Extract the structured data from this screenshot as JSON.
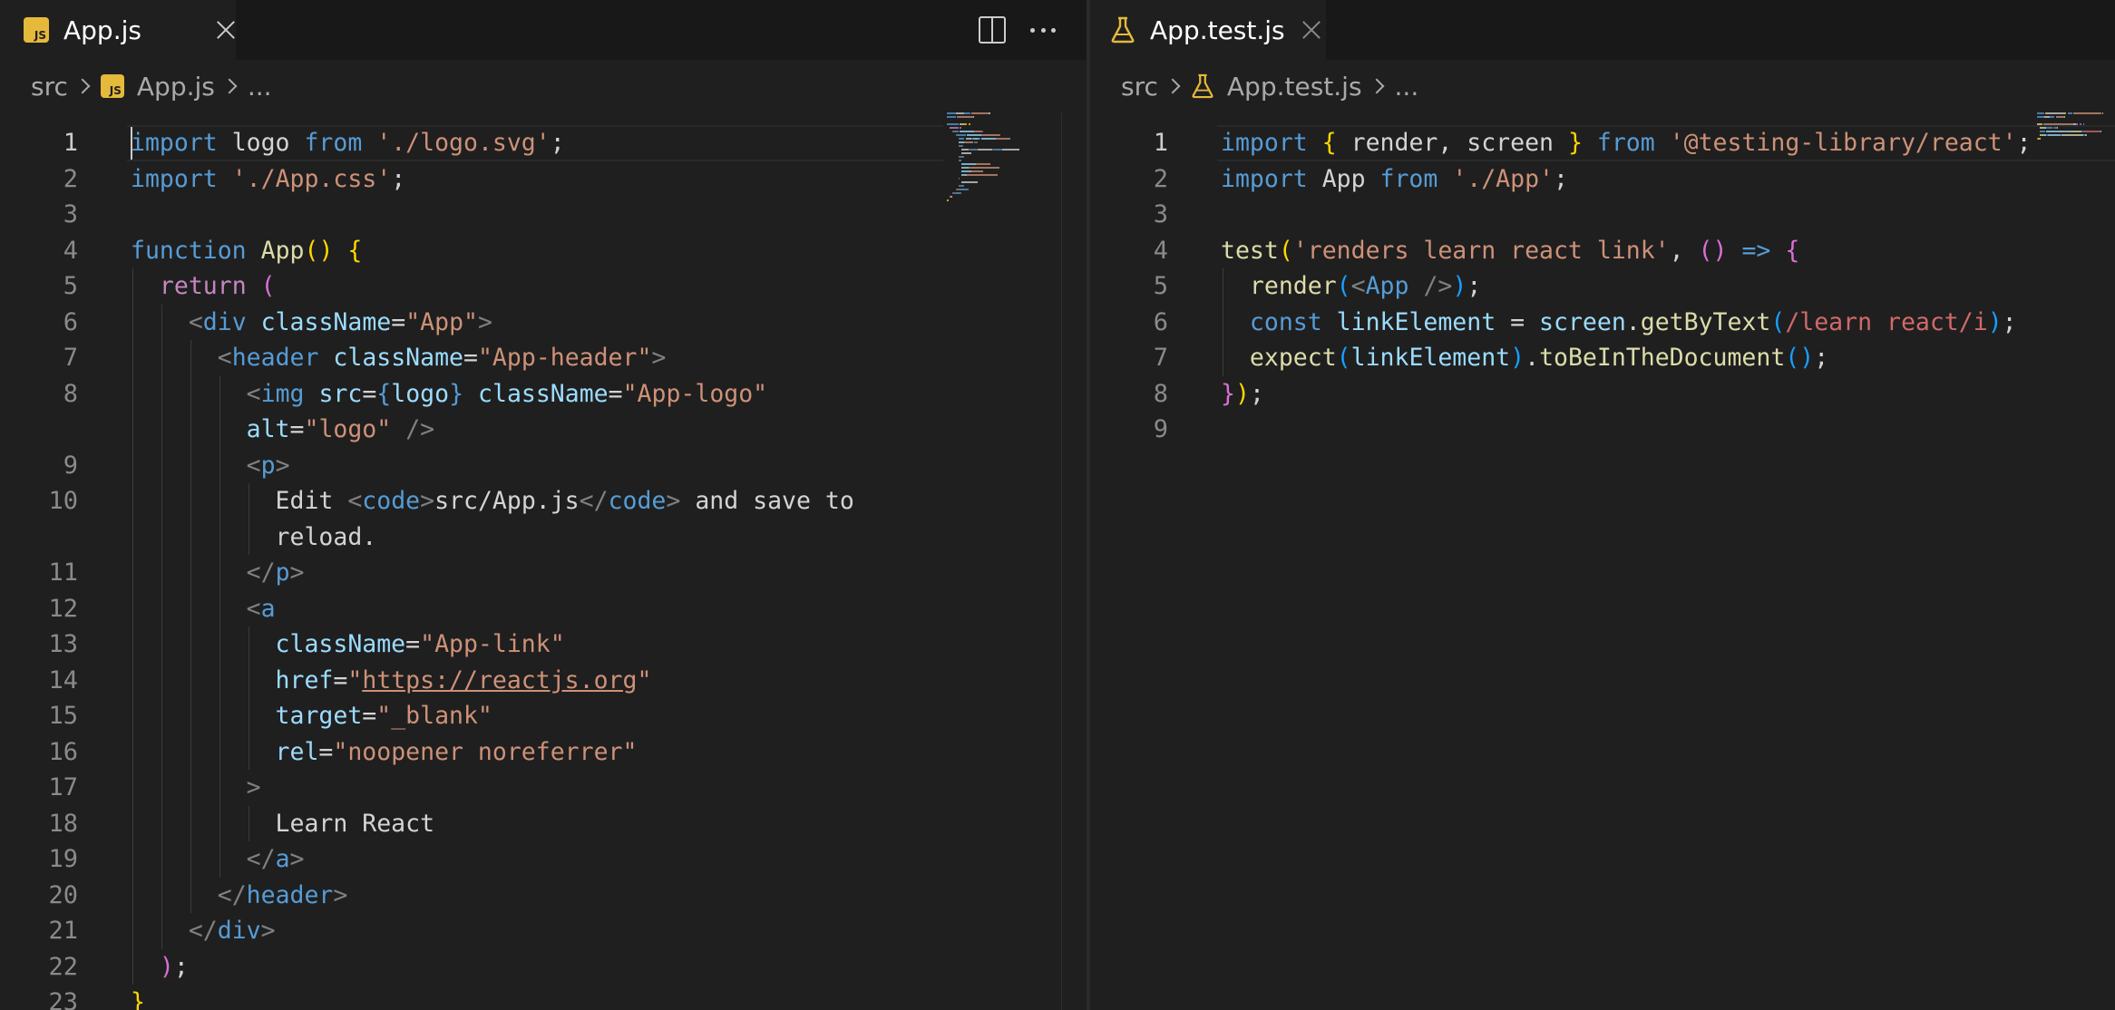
{
  "colors": {
    "editor_bg": "#1f1f1f",
    "tab_bar_bg": "#181818",
    "js_icon": "#e5b93a",
    "test_icon": "#e5b93a"
  },
  "left": {
    "tab": {
      "label": "App.js",
      "icon": "js-file-icon"
    },
    "breadcrumb": [
      "src",
      "App.js",
      "..."
    ],
    "current_line": 1,
    "lines": [
      {
        "n": "1",
        "i": 0,
        "t": [
          [
            "kw2",
            "import"
          ],
          [
            "txt",
            " logo "
          ],
          [
            "kw2",
            "from"
          ],
          [
            "txt",
            " "
          ],
          [
            "str",
            "'./logo.svg'"
          ],
          [
            "txt",
            ";"
          ]
        ]
      },
      {
        "n": "2",
        "i": 0,
        "t": [
          [
            "kw2",
            "import"
          ],
          [
            "txt",
            " "
          ],
          [
            "str",
            "'./App.css'"
          ],
          [
            "txt",
            ";"
          ]
        ]
      },
      {
        "n": "3",
        "i": 0,
        "t": []
      },
      {
        "n": "4",
        "i": 0,
        "t": [
          [
            "kw2",
            "function"
          ],
          [
            "txt",
            " "
          ],
          [
            "fn",
            "App"
          ],
          [
            "br1",
            "()"
          ],
          [
            "txt",
            " "
          ],
          [
            "br1",
            "{"
          ]
        ]
      },
      {
        "n": "5",
        "i": 1,
        "t": [
          [
            "kw",
            "return"
          ],
          [
            "txt",
            " "
          ],
          [
            "br2",
            "("
          ]
        ]
      },
      {
        "n": "6",
        "i": 2,
        "t": [
          [
            "punc",
            "<"
          ],
          [
            "tag",
            "div"
          ],
          [
            "txt",
            " "
          ],
          [
            "attr",
            "className"
          ],
          [
            "txt",
            "="
          ],
          [
            "str",
            "\"App\""
          ],
          [
            "punc",
            ">"
          ]
        ]
      },
      {
        "n": "7",
        "i": 3,
        "t": [
          [
            "punc",
            "<"
          ],
          [
            "tag",
            "header"
          ],
          [
            "txt",
            " "
          ],
          [
            "attr",
            "className"
          ],
          [
            "txt",
            "="
          ],
          [
            "str",
            "\"App-header\""
          ],
          [
            "punc",
            ">"
          ]
        ]
      },
      {
        "n": "8",
        "i": 4,
        "t": [
          [
            "punc",
            "<"
          ],
          [
            "tag",
            "img"
          ],
          [
            "txt",
            " "
          ],
          [
            "attr",
            "src"
          ],
          [
            "txt",
            "="
          ],
          [
            "kw2",
            "{"
          ],
          [
            "var",
            "logo"
          ],
          [
            "kw2",
            "}"
          ],
          [
            "txt",
            " "
          ],
          [
            "attr",
            "className"
          ],
          [
            "txt",
            "="
          ],
          [
            "str",
            "\"App-logo\""
          ]
        ]
      },
      {
        "n": "",
        "i": 4,
        "t": [
          [
            "attr",
            "alt"
          ],
          [
            "txt",
            "="
          ],
          [
            "str",
            "\"logo\""
          ],
          [
            "txt",
            " "
          ],
          [
            "punc",
            "/>"
          ]
        ]
      },
      {
        "n": "9",
        "i": 4,
        "t": [
          [
            "punc",
            "<"
          ],
          [
            "tag",
            "p"
          ],
          [
            "punc",
            ">"
          ]
        ]
      },
      {
        "n": "10",
        "i": 5,
        "t": [
          [
            "txt",
            "Edit "
          ],
          [
            "punc",
            "<"
          ],
          [
            "tag",
            "code"
          ],
          [
            "punc",
            ">"
          ],
          [
            "txt",
            "src/App.js"
          ],
          [
            "punc",
            "</"
          ],
          [
            "tag",
            "code"
          ],
          [
            "punc",
            ">"
          ],
          [
            "txt",
            " and save to"
          ]
        ]
      },
      {
        "n": "",
        "i": 5,
        "t": [
          [
            "txt",
            "reload."
          ]
        ]
      },
      {
        "n": "11",
        "i": 4,
        "t": [
          [
            "punc",
            "</"
          ],
          [
            "tag",
            "p"
          ],
          [
            "punc",
            ">"
          ]
        ]
      },
      {
        "n": "12",
        "i": 4,
        "t": [
          [
            "punc",
            "<"
          ],
          [
            "tag",
            "a"
          ]
        ]
      },
      {
        "n": "13",
        "i": 5,
        "t": [
          [
            "attr",
            "className"
          ],
          [
            "txt",
            "="
          ],
          [
            "str",
            "\"App-link\""
          ]
        ]
      },
      {
        "n": "14",
        "i": 5,
        "t": [
          [
            "attr",
            "href"
          ],
          [
            "txt",
            "="
          ],
          [
            "str",
            "\""
          ],
          [
            "link",
            "https://reactjs.org"
          ],
          [
            "str",
            "\""
          ]
        ]
      },
      {
        "n": "15",
        "i": 5,
        "t": [
          [
            "attr",
            "target"
          ],
          [
            "txt",
            "="
          ],
          [
            "str",
            "\"_blank\""
          ]
        ]
      },
      {
        "n": "16",
        "i": 5,
        "t": [
          [
            "attr",
            "rel"
          ],
          [
            "txt",
            "="
          ],
          [
            "str",
            "\"noopener noreferrer\""
          ]
        ]
      },
      {
        "n": "17",
        "i": 4,
        "t": [
          [
            "punc",
            ">"
          ]
        ]
      },
      {
        "n": "18",
        "i": 5,
        "t": [
          [
            "txt",
            "Learn React"
          ]
        ]
      },
      {
        "n": "19",
        "i": 4,
        "t": [
          [
            "punc",
            "</"
          ],
          [
            "tag",
            "a"
          ],
          [
            "punc",
            ">"
          ]
        ]
      },
      {
        "n": "20",
        "i": 3,
        "t": [
          [
            "punc",
            "</"
          ],
          [
            "tag",
            "header"
          ],
          [
            "punc",
            ">"
          ]
        ]
      },
      {
        "n": "21",
        "i": 2,
        "t": [
          [
            "punc",
            "</"
          ],
          [
            "tag",
            "div"
          ],
          [
            "punc",
            ">"
          ]
        ]
      },
      {
        "n": "22",
        "i": 1,
        "t": [
          [
            "br2",
            ")"
          ],
          [
            "txt",
            ";"
          ]
        ]
      },
      {
        "n": "23",
        "i": 0,
        "t": [
          [
            "br1",
            "}"
          ]
        ]
      }
    ]
  },
  "right": {
    "tab": {
      "label": "App.test.js",
      "icon": "beaker-icon"
    },
    "breadcrumb": [
      "src",
      "App.test.js",
      "..."
    ],
    "current_line": 1,
    "lines": [
      {
        "n": "1",
        "i": 0,
        "t": [
          [
            "kw2",
            "import"
          ],
          [
            "txt",
            " "
          ],
          [
            "br1",
            "{"
          ],
          [
            "txt",
            " render, screen "
          ],
          [
            "br1",
            "}"
          ],
          [
            "txt",
            " "
          ],
          [
            "kw2",
            "from"
          ],
          [
            "txt",
            " "
          ],
          [
            "str",
            "'@testing-library/react'"
          ],
          [
            "txt",
            ";"
          ]
        ]
      },
      {
        "n": "2",
        "i": 0,
        "t": [
          [
            "kw2",
            "import"
          ],
          [
            "txt",
            " App "
          ],
          [
            "kw2",
            "from"
          ],
          [
            "txt",
            " "
          ],
          [
            "str",
            "'./App'"
          ],
          [
            "txt",
            ";"
          ]
        ]
      },
      {
        "n": "3",
        "i": 0,
        "t": []
      },
      {
        "n": "4",
        "i": 0,
        "t": [
          [
            "fn",
            "test"
          ],
          [
            "br1",
            "("
          ],
          [
            "str",
            "'renders learn react link'"
          ],
          [
            "txt",
            ", "
          ],
          [
            "br2",
            "()"
          ],
          [
            "txt",
            " "
          ],
          [
            "kw2",
            "=>"
          ],
          [
            "txt",
            " "
          ],
          [
            "br2",
            "{"
          ]
        ]
      },
      {
        "n": "5",
        "i": 1,
        "t": [
          [
            "fn",
            "render"
          ],
          [
            "br3",
            "("
          ],
          [
            "punc",
            "<"
          ],
          [
            "tag",
            "App"
          ],
          [
            "txt",
            " "
          ],
          [
            "punc",
            "/>"
          ],
          [
            "br3",
            ")"
          ],
          [
            "txt",
            ";"
          ]
        ]
      },
      {
        "n": "6",
        "i": 1,
        "t": [
          [
            "kw2",
            "const"
          ],
          [
            "txt",
            " "
          ],
          [
            "var",
            "linkElement"
          ],
          [
            "txt",
            " = "
          ],
          [
            "var",
            "screen"
          ],
          [
            "txt",
            "."
          ],
          [
            "fn",
            "getByText"
          ],
          [
            "br3",
            "("
          ],
          [
            "rx",
            "/learn react/i"
          ],
          [
            "br3",
            ")"
          ],
          [
            "txt",
            ";"
          ]
        ]
      },
      {
        "n": "7",
        "i": 1,
        "t": [
          [
            "fn",
            "expect"
          ],
          [
            "br3",
            "("
          ],
          [
            "var",
            "linkElement"
          ],
          [
            "br3",
            ")"
          ],
          [
            "txt",
            "."
          ],
          [
            "fn",
            "toBeInTheDocument"
          ],
          [
            "br3",
            "()"
          ],
          [
            "txt",
            ";"
          ]
        ]
      },
      {
        "n": "8",
        "i": 0,
        "t": [
          [
            "br2",
            "}"
          ],
          [
            "br1",
            ")"
          ],
          [
            "txt",
            ";"
          ]
        ]
      },
      {
        "n": "9",
        "i": 0,
        "t": []
      }
    ]
  }
}
